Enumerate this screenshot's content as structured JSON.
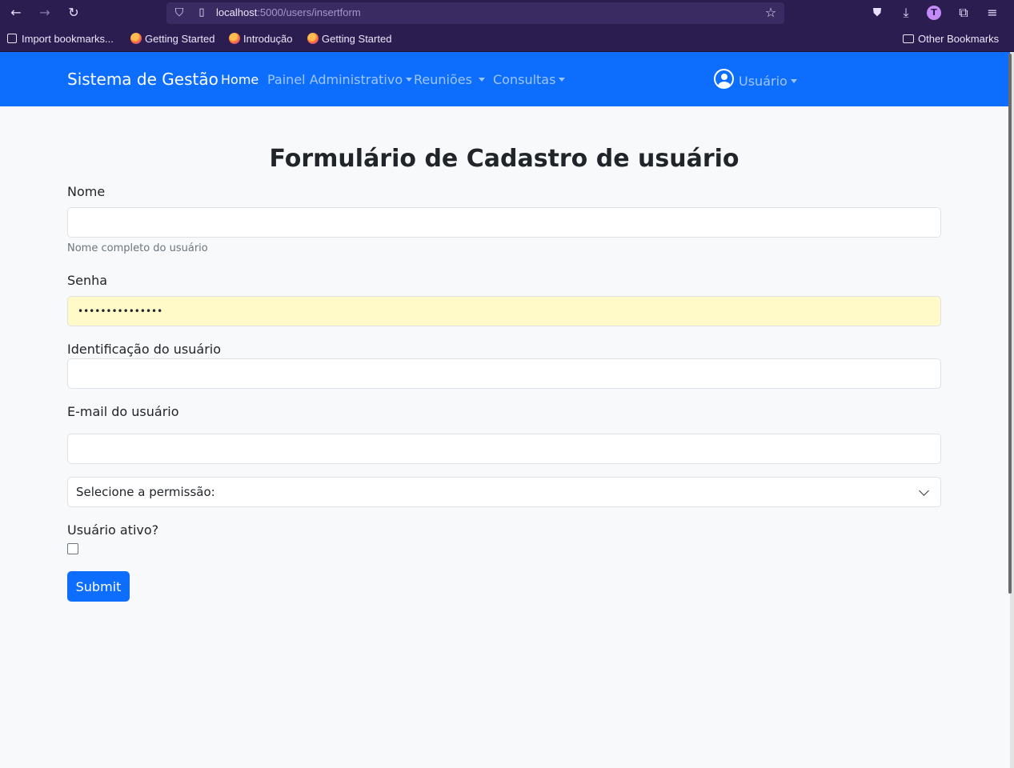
{
  "browser": {
    "url_host": "localhost",
    "url_path": ":5000/users/insertform",
    "bookmarks": [
      "Import bookmarks...",
      "Getting Started",
      "Introdução",
      "Getting Started"
    ],
    "other_bookmarks": "Other Bookmarks",
    "profile_initial": "T"
  },
  "navbar": {
    "brand": "Sistema de Gestão",
    "links": [
      "Home",
      "Painel Administrativo",
      "Reuniões",
      "Consultas"
    ],
    "user_label": "Usuário",
    "bg_color": "#0d6efd"
  },
  "form": {
    "title": "Formulário de Cadastro de usuário",
    "nome_label": "Nome",
    "nome_value": "",
    "nome_help": "Nome completo do usuário",
    "senha_label": "Senha",
    "senha_value": "•••••••••••••••",
    "ident_label": "Identificação do usuário",
    "ident_value": "",
    "email_label": "E-mail do usuário",
    "email_value": "",
    "permissao_select": "Selecione a permissão:",
    "ativo_label": "Usuário ativo?",
    "ativo_checked": false,
    "submit_label": "Submit"
  }
}
